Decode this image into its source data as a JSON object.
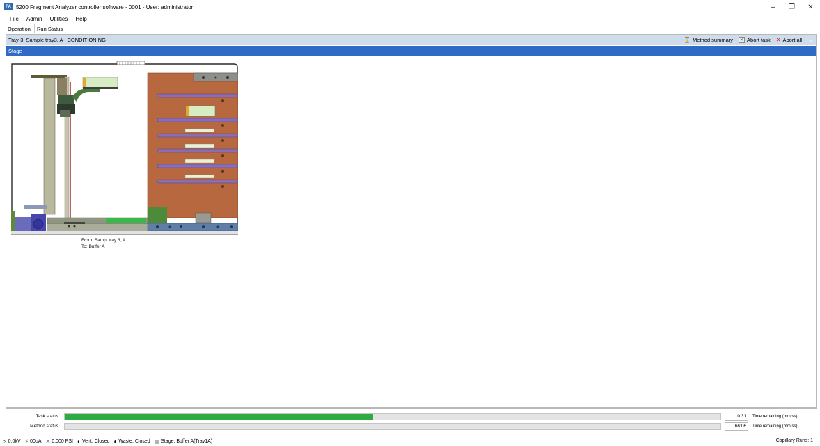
{
  "window": {
    "icon_text": "FA",
    "title": "5200 Fragment Analyzer controller software - 0001 - User: administrator",
    "minimize": "–",
    "restore": "❐",
    "close": "✕"
  },
  "menu": [
    "File",
    "Admin",
    "Utilities",
    "Help"
  ],
  "tabs": [
    {
      "label": "Operation",
      "active": false
    },
    {
      "label": "Run Status",
      "active": true
    }
  ],
  "sample_bar": {
    "sample": "Tray-3, Sample tray3, A",
    "state": "CONDITIONING",
    "actions": [
      {
        "label": "Method summary",
        "icon": "method-summary-icon",
        "glyph": "⌛"
      },
      {
        "label": "Abort task",
        "icon": "abort-task-icon",
        "glyph": "✕"
      },
      {
        "label": "Abort all",
        "icon": "abort-all-icon",
        "glyph": "✕"
      }
    ],
    "collapse_glyph": "⌄"
  },
  "stage": {
    "header": "Stage",
    "from": "From: Samp. tray 3, A",
    "to": "To: Buffer A"
  },
  "task_status": {
    "label": "Task status",
    "progress": 0.47,
    "time": "0:31",
    "time_label": "Time remaining (mm:ss)"
  },
  "method_status": {
    "label": "Method status",
    "progress": 0.0,
    "time": "66:06",
    "time_label": "Time remaining (mm:ss)"
  },
  "statusbar": {
    "items": [
      {
        "text": "0.0kV",
        "icon": "voltage-icon",
        "glyph": "⚡"
      },
      {
        "text": "00uA",
        "icon": "current-icon",
        "glyph": "⚡"
      },
      {
        "text": "0.000 PSI",
        "icon": "pressure-icon",
        "glyph": "✕"
      },
      {
        "text": "Vent: Closed",
        "icon": "vent-valve-icon",
        "glyph": "◐"
      },
      {
        "text": "Waste: Closed",
        "icon": "waste-valve-icon",
        "glyph": "◐"
      },
      {
        "text": "Stage: Buffer A(Tray1A)",
        "icon": "stage-icon",
        "glyph": "▤"
      }
    ],
    "capillary": "Capillary Runs: 1"
  },
  "colors": {
    "accent_blue": "#2f6ac4",
    "sample_bar": "#cfdcec",
    "progress_green": "#2fab46",
    "stage_brown": "#b8683e",
    "tray_purple": "#8b6db1"
  }
}
